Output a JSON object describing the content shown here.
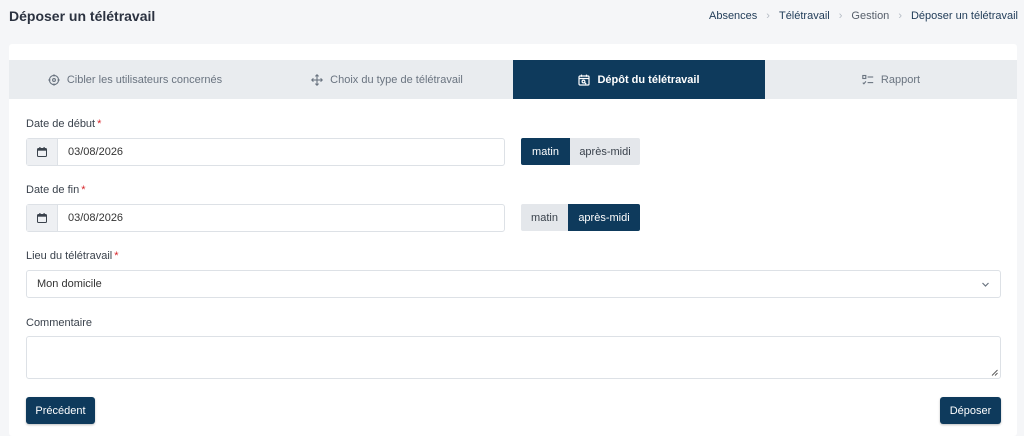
{
  "header": {
    "title": "Déposer un télétravail"
  },
  "breadcrumb": [
    "Absences",
    "Télétravail",
    "Gestion",
    "Déposer un télétravail"
  ],
  "steps": [
    {
      "label": "Cibler les utilisateurs concernés",
      "icon": "target-icon"
    },
    {
      "label": "Choix du type de télétravail",
      "icon": "move-arrows-icon"
    },
    {
      "label": "Dépôt du télétravail",
      "icon": "calendar-search-icon",
      "active": true
    },
    {
      "label": "Rapport",
      "icon": "checklist-icon"
    }
  ],
  "form": {
    "start": {
      "label": "Date de début",
      "required": "*",
      "value": "03/08/2026",
      "period": {
        "matin": "matin",
        "apres_midi": "après-midi",
        "selected": "matin"
      }
    },
    "end": {
      "label": "Date de fin",
      "required": "*",
      "value": "03/08/2026",
      "period": {
        "matin": "matin",
        "apres_midi": "après-midi",
        "selected": "après-midi"
      }
    },
    "location": {
      "label": "Lieu du télétravail",
      "required": "*",
      "value": "Mon domicile"
    },
    "comment": {
      "label": "Commentaire",
      "value": ""
    }
  },
  "actions": {
    "previous": "Précédent",
    "submit": "Déposer"
  },
  "colors": {
    "primary": "#0e3a5c",
    "required": "#d8262b"
  }
}
